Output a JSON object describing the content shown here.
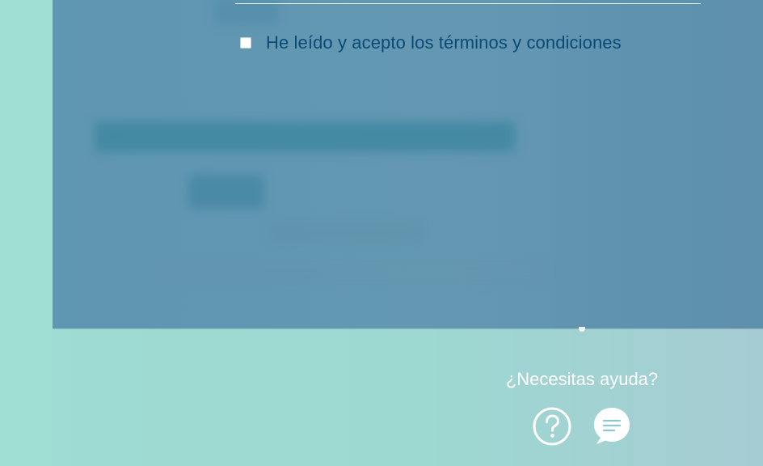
{
  "terms": {
    "checked": false,
    "label": "He leído y acepto los términos y condiciones"
  },
  "footer": {
    "help_text": "¿Necesitas ayuda?",
    "help_icon": "question-circle-icon",
    "chat_icon": "chat-bubble-icon"
  },
  "colors": {
    "panel": "#6298b1",
    "background": "#9fdcd3",
    "label": "#0c4a76"
  }
}
